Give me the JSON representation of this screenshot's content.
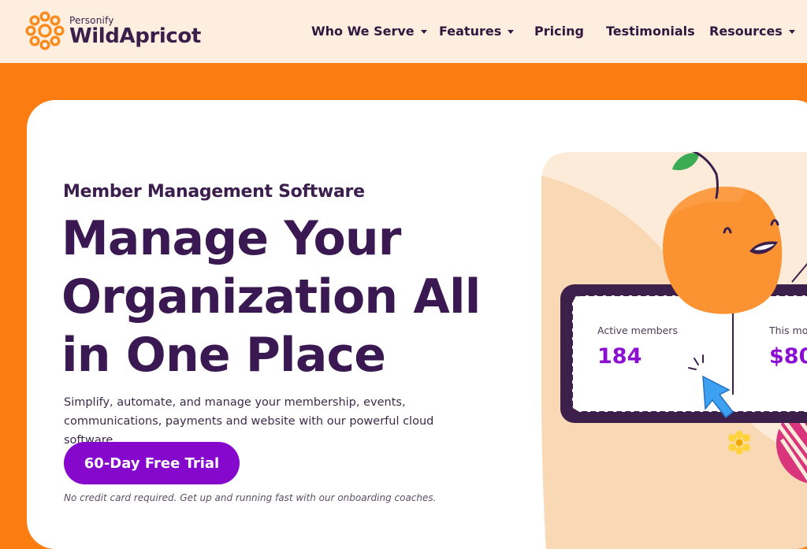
{
  "header": {
    "logo_small": "Personify",
    "logo_big": "WildApricot",
    "nav": [
      {
        "label": "Who We Serve",
        "has_dropdown": true
      },
      {
        "label": "Features",
        "has_dropdown": true
      },
      {
        "label": "Pricing",
        "has_dropdown": false
      },
      {
        "label": "Testimonials",
        "has_dropdown": false
      },
      {
        "label": "Resources",
        "has_dropdown": true
      }
    ]
  },
  "hero": {
    "eyebrow": "Member Management Software",
    "headline": "Manage Your Organization All in One Place",
    "subheading": "Simplify, automate, and manage your membership, events, communications, payments and website with our powerful cloud software.",
    "cta_label": "60-Day Free Trial",
    "note": "No credit card required. Get up and running fast with our onboarding coaches."
  },
  "illustration": {
    "stats": [
      {
        "label": "Active members",
        "value": "184"
      },
      {
        "label": "This mon",
        "value": "$80"
      }
    ]
  },
  "colors": {
    "brand_orange": "#fb7c10",
    "header_bg": "#fdeee0",
    "text_purple": "#3a1952",
    "cta_purple": "#8508cc",
    "stat_purple": "#8a0fd1"
  }
}
